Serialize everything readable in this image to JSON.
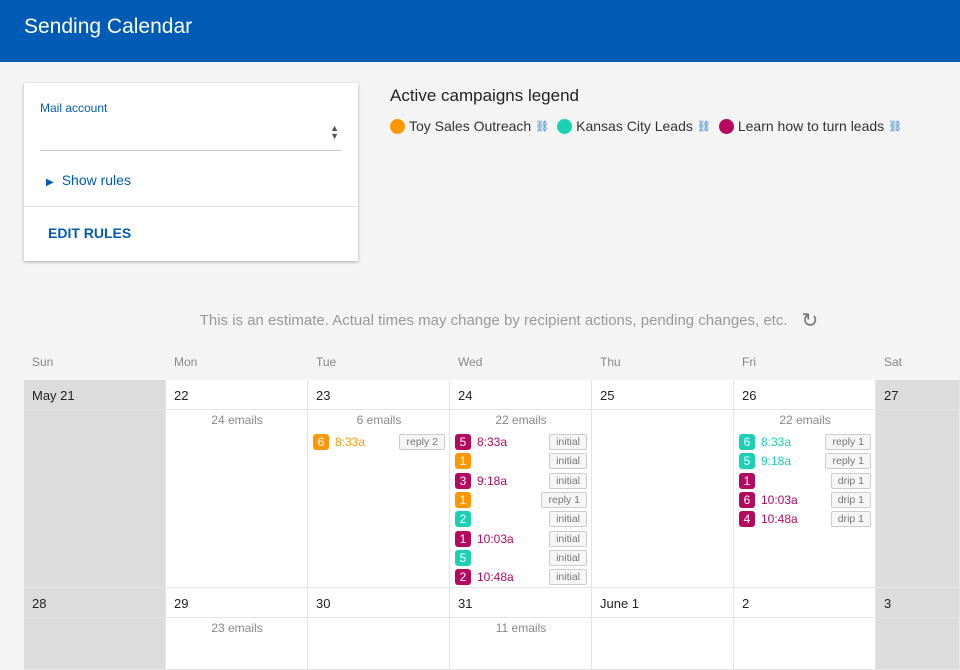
{
  "header": {
    "title": "Sending Calendar"
  },
  "settings": {
    "mail_account_label": "Mail account",
    "show_rules": "Show rules",
    "edit_rules": "EDIT RULES"
  },
  "legend": {
    "title": "Active campaigns legend",
    "campaigns": [
      {
        "name": "Toy Sales Outreach",
        "color": "#ff9800"
      },
      {
        "name": "Kansas City Leads",
        "color": "#1bd1b3"
      },
      {
        "name": "Learn how to turn leads",
        "color": "#b5095f"
      }
    ]
  },
  "note": "This is an estimate. Actual times may change by recipient actions, pending changes, etc.",
  "days": [
    "Sun",
    "Mon",
    "Tue",
    "Wed",
    "Thu",
    "Fri",
    "Sat"
  ],
  "weeks": [
    {
      "dates": [
        "May  21",
        "22",
        "23",
        "24",
        "25",
        "26",
        "27"
      ],
      "counts": [
        "",
        "24 emails",
        "6 emails",
        "22 emails",
        "",
        "22 emails",
        ""
      ],
      "entries": [
        [],
        [],
        [
          {
            "n": "6",
            "c": 0,
            "t": "8:33a",
            "tag": "reply 2"
          }
        ],
        [
          {
            "n": "5",
            "c": 2,
            "t": "8:33a",
            "tag": "initial"
          },
          {
            "n": "1",
            "c": 0,
            "t": "",
            "tag": "initial"
          },
          {
            "n": "3",
            "c": 2,
            "t": "9:18a",
            "tag": "initial"
          },
          {
            "n": "1",
            "c": 0,
            "t": "",
            "tag": "reply 1"
          },
          {
            "n": "2",
            "c": 1,
            "t": "",
            "tag": "initial"
          },
          {
            "n": "1",
            "c": 2,
            "t": "10:03a",
            "tag": "initial"
          },
          {
            "n": "5",
            "c": 1,
            "t": "",
            "tag": "initial"
          },
          {
            "n": "2",
            "c": 2,
            "t": "10:48a",
            "tag": "initial"
          }
        ],
        [],
        [
          {
            "n": "6",
            "c": 1,
            "t": "8:33a",
            "tag": "reply 1"
          },
          {
            "n": "5",
            "c": 1,
            "t": "9:18a",
            "tag": "reply 1"
          },
          {
            "n": "1",
            "c": 2,
            "t": "",
            "tag": "drip 1"
          },
          {
            "n": "6",
            "c": 2,
            "t": "10:03a",
            "tag": "drip 1"
          },
          {
            "n": "4",
            "c": 2,
            "t": "10:48a",
            "tag": "drip 1"
          }
        ],
        []
      ]
    },
    {
      "dates": [
        "28",
        "29",
        "30",
        "31",
        "June  1",
        "2",
        "3"
      ],
      "counts": [
        "",
        "23 emails",
        "",
        "11 emails",
        "",
        "",
        ""
      ],
      "entries": [
        [],
        [],
        [],
        [],
        [],
        [],
        []
      ]
    }
  ]
}
